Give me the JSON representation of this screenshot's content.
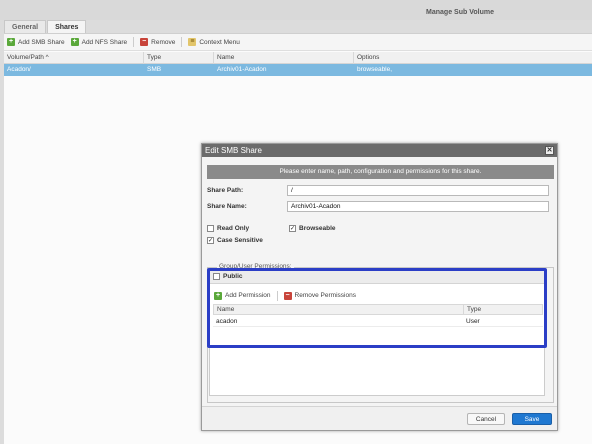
{
  "window": {
    "title": "Manage Sub Volume"
  },
  "tabs": [
    {
      "label": "General",
      "active": false
    },
    {
      "label": "Shares",
      "active": true
    }
  ],
  "toolbar": {
    "add_smb": "Add SMB Share",
    "add_nfs": "Add NFS Share",
    "remove": "Remove",
    "context_menu": "Context Menu"
  },
  "shares_grid": {
    "columns": [
      "Volume/Path ^",
      "Type",
      "Name",
      "Options"
    ],
    "rows": [
      {
        "path": "Acadon/",
        "type": "SMB",
        "name": "Archiv01-Acadon",
        "options": "browseable,"
      }
    ]
  },
  "dialog": {
    "title": "Edit SMB Share",
    "close_symbol": "✕",
    "banner": "Please enter name, path, configuration and permissions for this share.",
    "share_path_label": "Share Path:",
    "share_path_value": "/",
    "share_name_label": "Share Name:",
    "share_name_value": "Archiv01-Acadon",
    "read_only_label": "Read Only",
    "read_only_checked": false,
    "browseable_label": "Browseable",
    "browseable_checked": true,
    "case_sensitive_label": "Case Sensitive",
    "case_sensitive_checked": true,
    "permissions_legend": "Group/User Permissions:",
    "public_label": "Public",
    "public_checked": false,
    "add_permission": "Add Permission",
    "remove_permissions": "Remove Permissions",
    "perm_columns": [
      "Name",
      "Type"
    ],
    "perm_rows": [
      {
        "name": "acadon",
        "type": "User"
      }
    ],
    "cancel": "Cancel",
    "save": "Save"
  },
  "colors": {
    "selection_row": "#7cb9e0",
    "highlight_box": "#2b3ec6",
    "save_button": "#1f78d1"
  }
}
